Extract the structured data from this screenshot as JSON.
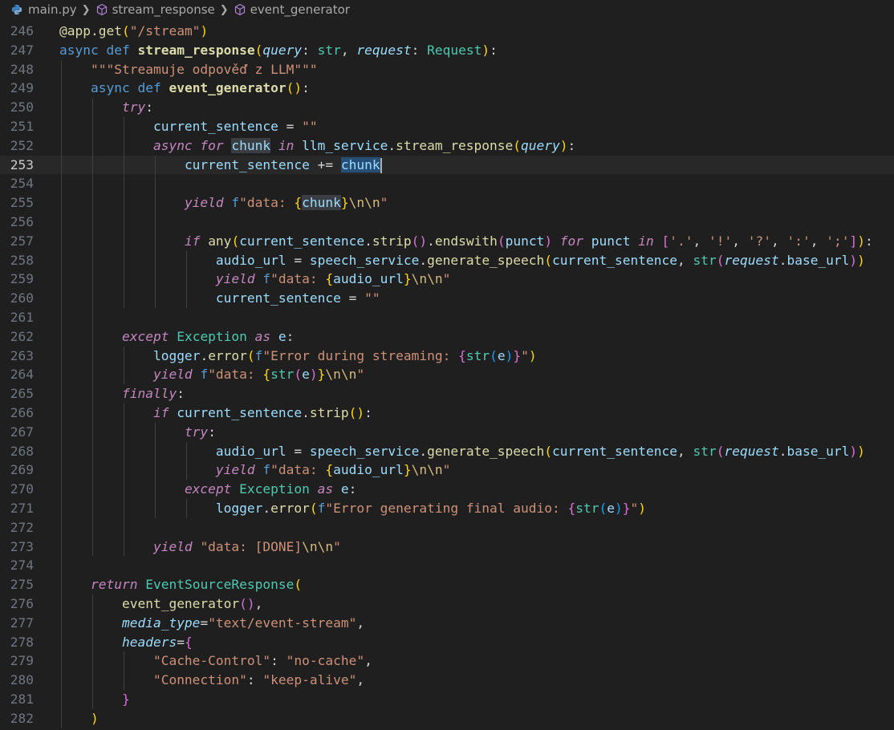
{
  "breadcrumb": {
    "file": "main.py",
    "items": [
      "stream_response",
      "event_generator"
    ]
  },
  "editor": {
    "current_line": 253,
    "lines": [
      {
        "n": "246",
        "tokens": [
          [
            "dec",
            "@app.get"
          ],
          [
            "br1",
            "("
          ],
          [
            "str",
            "\"/stream\""
          ],
          [
            "br1",
            ")"
          ]
        ]
      },
      {
        "n": "247",
        "tokens": [
          [
            "kw",
            "async def "
          ],
          [
            "fnb",
            "stream_response"
          ],
          [
            "br1",
            "("
          ],
          [
            "param",
            "query"
          ],
          [
            "pl",
            ": "
          ],
          [
            "type",
            "str"
          ],
          [
            "pl",
            ", "
          ],
          [
            "param",
            "request"
          ],
          [
            "pl",
            ": "
          ],
          [
            "type",
            "Request"
          ],
          [
            "br1",
            ")"
          ],
          [
            "pl",
            ":"
          ]
        ]
      },
      {
        "n": "248",
        "tokens": [
          [
            "pl",
            "    "
          ],
          [
            "str",
            "\"\"\"Streamuje odpověď z LLM\"\"\""
          ]
        ]
      },
      {
        "n": "249",
        "tokens": [
          [
            "pl",
            "    "
          ],
          [
            "kw",
            "async def "
          ],
          [
            "fnb",
            "event_generator"
          ],
          [
            "br1",
            "()"
          ],
          [
            "pl",
            ":"
          ]
        ]
      },
      {
        "n": "250",
        "tokens": [
          [
            "pl",
            "        "
          ],
          [
            "kwi",
            "try"
          ],
          [
            "pl",
            ":"
          ]
        ]
      },
      {
        "n": "251",
        "tokens": [
          [
            "pl",
            "            "
          ],
          [
            "var",
            "current_sentence"
          ],
          [
            "pl",
            " = "
          ],
          [
            "str",
            "\"\""
          ]
        ]
      },
      {
        "n": "252",
        "tokens": [
          [
            "pl",
            "            "
          ],
          [
            "kwi",
            "async for "
          ],
          [
            "var hl",
            "chunk"
          ],
          [
            "kwi",
            " in "
          ],
          [
            "var",
            "llm_service"
          ],
          [
            "pl",
            "."
          ],
          [
            "fn",
            "stream_response"
          ],
          [
            "br1",
            "("
          ],
          [
            "param",
            "query"
          ],
          [
            "br1",
            ")"
          ],
          [
            "pl",
            ":"
          ]
        ]
      },
      {
        "n": "253",
        "tokens": [
          [
            "pl",
            "                "
          ],
          [
            "var",
            "current_sentence"
          ],
          [
            "pl",
            " += "
          ],
          [
            "var hlw",
            "chunk"
          ]
        ]
      },
      {
        "n": "254",
        "tokens": []
      },
      {
        "n": "255",
        "tokens": [
          [
            "pl",
            "                "
          ],
          [
            "kwi",
            "yield "
          ],
          [
            "kw",
            "f"
          ],
          [
            "str",
            "\"data: "
          ],
          [
            "br1",
            "{"
          ],
          [
            "var hl",
            "chunk"
          ],
          [
            "br1",
            "}"
          ],
          [
            "esc",
            "\\n\\n"
          ],
          [
            "str",
            "\""
          ]
        ]
      },
      {
        "n": "256",
        "tokens": []
      },
      {
        "n": "257",
        "tokens": [
          [
            "pl",
            "                "
          ],
          [
            "kwi",
            "if "
          ],
          [
            "fn",
            "any"
          ],
          [
            "br1",
            "("
          ],
          [
            "var",
            "current_sentence"
          ],
          [
            "pl",
            "."
          ],
          [
            "fn",
            "strip"
          ],
          [
            "br2",
            "()"
          ],
          [
            "pl",
            "."
          ],
          [
            "fn",
            "endswith"
          ],
          [
            "br2",
            "("
          ],
          [
            "var",
            "punct"
          ],
          [
            "br2",
            ")"
          ],
          [
            "kwi",
            " for "
          ],
          [
            "var",
            "punct"
          ],
          [
            "kwi",
            " in "
          ],
          [
            "br2",
            "["
          ],
          [
            "str",
            "'.'"
          ],
          [
            "pl",
            ", "
          ],
          [
            "str",
            "'!'"
          ],
          [
            "pl",
            ", "
          ],
          [
            "str",
            "'?'"
          ],
          [
            "pl",
            ", "
          ],
          [
            "str",
            "':'"
          ],
          [
            "pl",
            ", "
          ],
          [
            "str",
            "';'"
          ],
          [
            "br2",
            "]"
          ],
          [
            "br1",
            ")"
          ],
          [
            "pl",
            ":"
          ]
        ]
      },
      {
        "n": "258",
        "tokens": [
          [
            "pl",
            "                    "
          ],
          [
            "var",
            "audio_url"
          ],
          [
            "pl",
            " = "
          ],
          [
            "var",
            "speech_service"
          ],
          [
            "pl",
            "."
          ],
          [
            "fn",
            "generate_speech"
          ],
          [
            "br1",
            "("
          ],
          [
            "var",
            "current_sentence"
          ],
          [
            "pl",
            ", "
          ],
          [
            "type",
            "str"
          ],
          [
            "br2",
            "("
          ],
          [
            "param",
            "request"
          ],
          [
            "pl",
            "."
          ],
          [
            "var",
            "base_url"
          ],
          [
            "br2",
            ")"
          ],
          [
            "br1",
            ")"
          ]
        ]
      },
      {
        "n": "259",
        "tokens": [
          [
            "pl",
            "                    "
          ],
          [
            "kwi",
            "yield "
          ],
          [
            "kw",
            "f"
          ],
          [
            "str",
            "\"data: "
          ],
          [
            "br1",
            "{"
          ],
          [
            "var",
            "audio_url"
          ],
          [
            "br1",
            "}"
          ],
          [
            "esc",
            "\\n\\n"
          ],
          [
            "str",
            "\""
          ]
        ]
      },
      {
        "n": "260",
        "tokens": [
          [
            "pl",
            "                    "
          ],
          [
            "var",
            "current_sentence"
          ],
          [
            "pl",
            " = "
          ],
          [
            "str",
            "\"\""
          ]
        ]
      },
      {
        "n": "261",
        "tokens": []
      },
      {
        "n": "262",
        "tokens": [
          [
            "pl",
            "        "
          ],
          [
            "kwi",
            "except "
          ],
          [
            "type",
            "Exception"
          ],
          [
            "kwi",
            " as "
          ],
          [
            "var",
            "e"
          ],
          [
            "pl",
            ":"
          ]
        ]
      },
      {
        "n": "263",
        "tokens": [
          [
            "pl",
            "            "
          ],
          [
            "var",
            "logger"
          ],
          [
            "pl",
            "."
          ],
          [
            "fn",
            "error"
          ],
          [
            "br1",
            "("
          ],
          [
            "kw",
            "f"
          ],
          [
            "str",
            "\"Error during streaming: "
          ],
          [
            "br2",
            "{"
          ],
          [
            "type",
            "str"
          ],
          [
            "br3",
            "("
          ],
          [
            "var",
            "e"
          ],
          [
            "br3",
            ")"
          ],
          [
            "br2",
            "}"
          ],
          [
            "str",
            "\""
          ],
          [
            "br1",
            ")"
          ]
        ]
      },
      {
        "n": "264",
        "tokens": [
          [
            "pl",
            "            "
          ],
          [
            "kwi",
            "yield "
          ],
          [
            "kw",
            "f"
          ],
          [
            "str",
            "\"data: "
          ],
          [
            "br1",
            "{"
          ],
          [
            "type",
            "str"
          ],
          [
            "br2",
            "("
          ],
          [
            "var",
            "e"
          ],
          [
            "br2",
            ")"
          ],
          [
            "br1",
            "}"
          ],
          [
            "esc",
            "\\n\\n"
          ],
          [
            "str",
            "\""
          ]
        ]
      },
      {
        "n": "265",
        "tokens": [
          [
            "pl",
            "        "
          ],
          [
            "kwi",
            "finally"
          ],
          [
            "pl",
            ":"
          ]
        ]
      },
      {
        "n": "266",
        "tokens": [
          [
            "pl",
            "            "
          ],
          [
            "kwi",
            "if "
          ],
          [
            "var",
            "current_sentence"
          ],
          [
            "pl",
            "."
          ],
          [
            "fn",
            "strip"
          ],
          [
            "br1",
            "()"
          ],
          [
            "pl",
            ":"
          ]
        ]
      },
      {
        "n": "267",
        "tokens": [
          [
            "pl",
            "                "
          ],
          [
            "kwi",
            "try"
          ],
          [
            "pl",
            ":"
          ]
        ]
      },
      {
        "n": "268",
        "tokens": [
          [
            "pl",
            "                    "
          ],
          [
            "var",
            "audio_url"
          ],
          [
            "pl",
            " = "
          ],
          [
            "var",
            "speech_service"
          ],
          [
            "pl",
            "."
          ],
          [
            "fn",
            "generate_speech"
          ],
          [
            "br1",
            "("
          ],
          [
            "var",
            "current_sentence"
          ],
          [
            "pl",
            ", "
          ],
          [
            "type",
            "str"
          ],
          [
            "br2",
            "("
          ],
          [
            "param",
            "request"
          ],
          [
            "pl",
            "."
          ],
          [
            "var",
            "base_url"
          ],
          [
            "br2",
            ")"
          ],
          [
            "br1",
            ")"
          ]
        ]
      },
      {
        "n": "269",
        "tokens": [
          [
            "pl",
            "                    "
          ],
          [
            "kwi",
            "yield "
          ],
          [
            "kw",
            "f"
          ],
          [
            "str",
            "\"data: "
          ],
          [
            "br1",
            "{"
          ],
          [
            "var",
            "audio_url"
          ],
          [
            "br1",
            "}"
          ],
          [
            "esc",
            "\\n\\n"
          ],
          [
            "str",
            "\""
          ]
        ]
      },
      {
        "n": "270",
        "tokens": [
          [
            "pl",
            "                "
          ],
          [
            "kwi",
            "except "
          ],
          [
            "type",
            "Exception"
          ],
          [
            "kwi",
            " as "
          ],
          [
            "var",
            "e"
          ],
          [
            "pl",
            ":"
          ]
        ]
      },
      {
        "n": "271",
        "tokens": [
          [
            "pl",
            "                    "
          ],
          [
            "var",
            "logger"
          ],
          [
            "pl",
            "."
          ],
          [
            "fn",
            "error"
          ],
          [
            "br1",
            "("
          ],
          [
            "kw",
            "f"
          ],
          [
            "str",
            "\"Error generating final audio: "
          ],
          [
            "br2",
            "{"
          ],
          [
            "type",
            "str"
          ],
          [
            "br3",
            "("
          ],
          [
            "var",
            "e"
          ],
          [
            "br3",
            ")"
          ],
          [
            "br2",
            "}"
          ],
          [
            "str",
            "\""
          ],
          [
            "br1",
            ")"
          ]
        ]
      },
      {
        "n": "272",
        "tokens": []
      },
      {
        "n": "273",
        "tokens": [
          [
            "pl",
            "            "
          ],
          [
            "kwi",
            "yield "
          ],
          [
            "str",
            "\"data: [DONE]"
          ],
          [
            "esc",
            "\\n\\n"
          ],
          [
            "str",
            "\""
          ]
        ]
      },
      {
        "n": "274",
        "tokens": []
      },
      {
        "n": "275",
        "tokens": [
          [
            "pl",
            "    "
          ],
          [
            "kwi",
            "return "
          ],
          [
            "type",
            "EventSourceResponse"
          ],
          [
            "br1",
            "("
          ]
        ]
      },
      {
        "n": "276",
        "tokens": [
          [
            "pl",
            "        "
          ],
          [
            "fn",
            "event_generator"
          ],
          [
            "br2",
            "()"
          ],
          [
            "pl",
            ","
          ]
        ]
      },
      {
        "n": "277",
        "tokens": [
          [
            "pl",
            "        "
          ],
          [
            "param",
            "media_type"
          ],
          [
            "pl",
            "="
          ],
          [
            "str",
            "\"text/event-stream\""
          ],
          [
            "pl",
            ","
          ]
        ]
      },
      {
        "n": "278",
        "tokens": [
          [
            "pl",
            "        "
          ],
          [
            "param",
            "headers"
          ],
          [
            "pl",
            "="
          ],
          [
            "br2",
            "{"
          ]
        ]
      },
      {
        "n": "279",
        "tokens": [
          [
            "pl",
            "            "
          ],
          [
            "str",
            "\"Cache-Control\""
          ],
          [
            "pl",
            ": "
          ],
          [
            "str",
            "\"no-cache\""
          ],
          [
            "pl",
            ","
          ]
        ]
      },
      {
        "n": "280",
        "tokens": [
          [
            "pl",
            "            "
          ],
          [
            "str",
            "\"Connection\""
          ],
          [
            "pl",
            ": "
          ],
          [
            "str",
            "\"keep-alive\""
          ],
          [
            "pl",
            ","
          ]
        ]
      },
      {
        "n": "281",
        "tokens": [
          [
            "pl",
            "        "
          ],
          [
            "br2",
            "}"
          ]
        ]
      },
      {
        "n": "282",
        "tokens": [
          [
            "pl",
            "    "
          ],
          [
            "br1",
            ")"
          ]
        ]
      }
    ]
  }
}
